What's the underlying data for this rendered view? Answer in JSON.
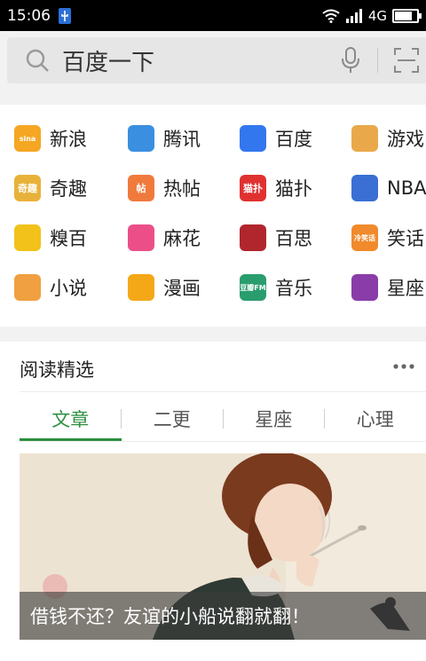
{
  "status_bar": {
    "time": "15:06",
    "network": "4G"
  },
  "search": {
    "placeholder": "百度一下"
  },
  "nav_items": [
    {
      "label": "新浪",
      "icon": "sina-icon",
      "badge": "sina",
      "color": "#f5a623"
    },
    {
      "label": "腾讯",
      "icon": "tencent-icon",
      "badge": "",
      "color": "#3a8fe0"
    },
    {
      "label": "百度",
      "icon": "baidu-icon",
      "badge": "",
      "color": "#3377ee"
    },
    {
      "label": "游戏",
      "icon": "game-icon",
      "badge": "",
      "color": "#e9a94b"
    },
    {
      "label": "奇趣",
      "icon": "qiqu-icon",
      "badge": "奇趣",
      "color": "#e8b23a"
    },
    {
      "label": "热帖",
      "icon": "hot-post-icon",
      "badge": "帖",
      "color": "#f07a3c"
    },
    {
      "label": "猫扑",
      "icon": "mop-icon",
      "badge": "猫扑",
      "color": "#e03131"
    },
    {
      "label": "NBA",
      "icon": "nba-icon",
      "badge": "",
      "color": "#3b6fd4"
    },
    {
      "label": "糗百",
      "icon": "qiubai-icon",
      "badge": "",
      "color": "#f2c21a"
    },
    {
      "label": "麻花",
      "icon": "mahua-icon",
      "badge": "",
      "color": "#ec4f87"
    },
    {
      "label": "百思",
      "icon": "baisi-icon",
      "badge": "",
      "color": "#b0262c"
    },
    {
      "label": "笑话",
      "icon": "joke-icon",
      "badge": "冷笑话",
      "color": "#f08a2c"
    },
    {
      "label": "小说",
      "icon": "novel-icon",
      "badge": "",
      "color": "#f0a040"
    },
    {
      "label": "漫画",
      "icon": "comic-icon",
      "badge": "",
      "color": "#f5a817"
    },
    {
      "label": "音乐",
      "icon": "music-icon",
      "badge": "豆瓣FM",
      "color": "#2a9d6e"
    },
    {
      "label": "星座",
      "icon": "horoscope-icon",
      "badge": "",
      "color": "#8a3ca8"
    }
  ],
  "reading": {
    "title": "阅读精选",
    "tabs": [
      {
        "label": "文章",
        "active": true
      },
      {
        "label": "二更",
        "active": false
      },
      {
        "label": "星座",
        "active": false
      },
      {
        "label": "心理",
        "active": false
      }
    ],
    "article_title": "借钱不还？友谊的小船说翻就翻！"
  },
  "accent_color": "#2d8f3f"
}
